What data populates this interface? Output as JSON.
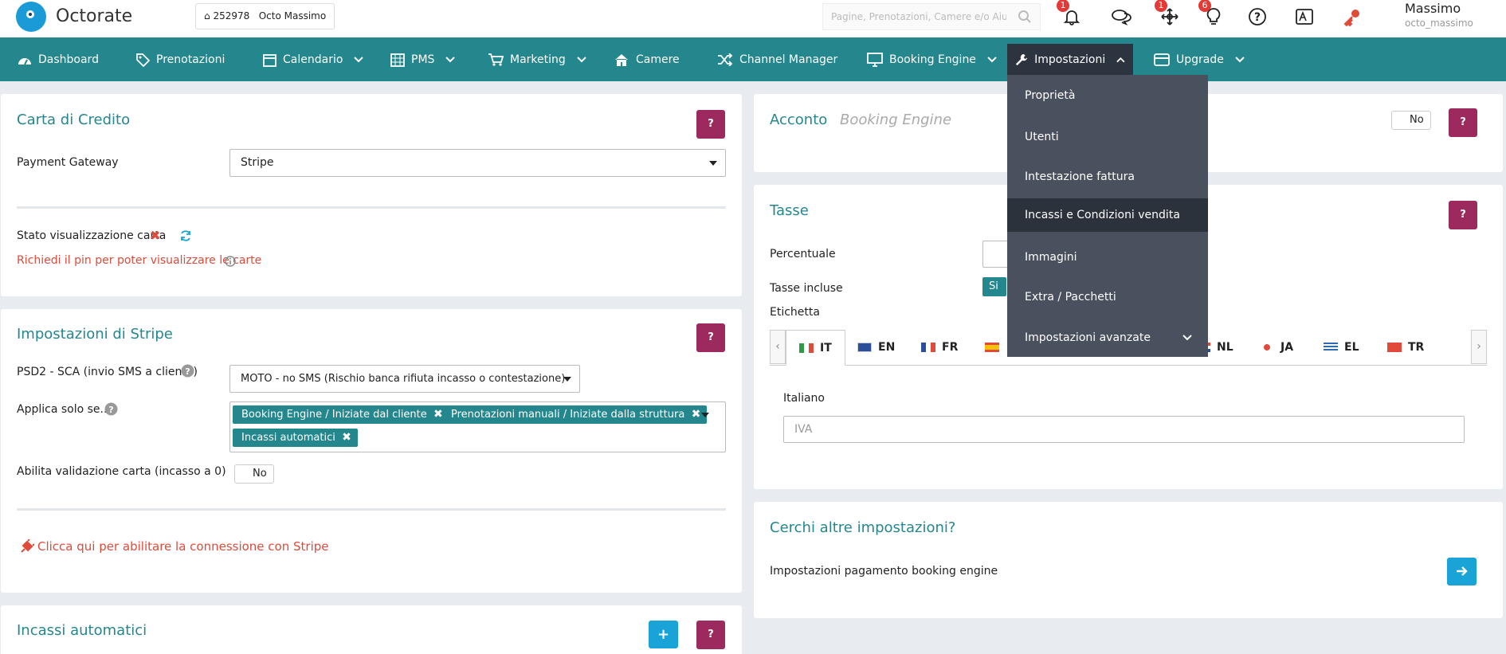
{
  "app": {
    "name": "Octorate"
  },
  "topbar": {
    "property_id": "252978",
    "property_name": "Octo Massimo",
    "search_placeholder": "Pagine, Prenotazioni, Camere e/o Aiuto",
    "badges": {
      "notifications": "1",
      "connections": "1",
      "ideas": "6"
    },
    "user_name": "Massimo",
    "user_login": "octo_massimo"
  },
  "nav": {
    "items": [
      {
        "label": "Dashboard",
        "icon": "dashboard-icon"
      },
      {
        "label": "Prenotazioni",
        "icon": "tag-icon"
      },
      {
        "label": "Calendario",
        "icon": "calendar-icon"
      },
      {
        "label": "PMS",
        "icon": "calendar-grid-icon"
      },
      {
        "label": "Marketing",
        "icon": "cart-icon"
      },
      {
        "label": "Camere",
        "icon": "home-icon"
      },
      {
        "label": "Channel Manager",
        "icon": "shuffle-icon"
      },
      {
        "label": "Booking Engine",
        "icon": "monitor-icon"
      },
      {
        "label": "Impostazioni",
        "icon": "wrench-icon"
      },
      {
        "label": "Upgrade",
        "icon": "credit-card-icon"
      }
    ]
  },
  "dropdown": {
    "items": [
      "Proprietà",
      "Utenti",
      "Intestazione fattura",
      "Incassi e Condizioni vendita",
      "Immagini",
      "Extra / Pacchetti",
      "Impostazioni avanzate"
    ]
  },
  "carta": {
    "title": "Carta di Credito",
    "gateway_label": "Payment Gateway",
    "gateway_value": "Stripe",
    "stato_label": "Stato visualizzazione carta",
    "pin_note": "Richiedi il pin per poter visualizzare le carte"
  },
  "stripe": {
    "title": "Impostazioni di Stripe",
    "psd2_label": "PSD2 - SCA (invio SMS a cliente)",
    "psd2_value": "MOTO - no SMS (Rischio banca rifiuta incasso o contestazione)",
    "applica_label": "Applica solo se...",
    "tags": [
      "Booking Engine / Iniziate dal cliente",
      "Prenotazioni manuali / Iniziate dalla struttura",
      "Incassi automatici"
    ],
    "validazione_label": "Abilita validazione carta (incasso a 0)",
    "validazione_value": "No",
    "connect_link": "Clicca qui per abilitare la connessione con Stripe"
  },
  "incassi": {
    "title": "Incassi automatici"
  },
  "acconto": {
    "title": "Acconto",
    "subtitle": "Booking Engine",
    "toggle_value": "No"
  },
  "tasse": {
    "title": "Tasse",
    "percentuale_label": "Percentuale",
    "incluse_label": "Tasse incluse",
    "incluse_value": "Si",
    "etichetta_label": "Etichetta",
    "languages": [
      "IT",
      "EN",
      "FR",
      "NL",
      "JA",
      "EL",
      "TR"
    ],
    "italiano_label": "Italiano",
    "iva_placeholder": "IVA"
  },
  "cerchi": {
    "title": "Cerchi altre impostazioni?",
    "link_label": "Impostazioni pagamento booking engine"
  },
  "colors": {
    "teal": "#24878e",
    "plum": "#9c2a5e",
    "red": "#e04a3a",
    "blue": "#1aa3d6",
    "dark": "#4a515e"
  }
}
